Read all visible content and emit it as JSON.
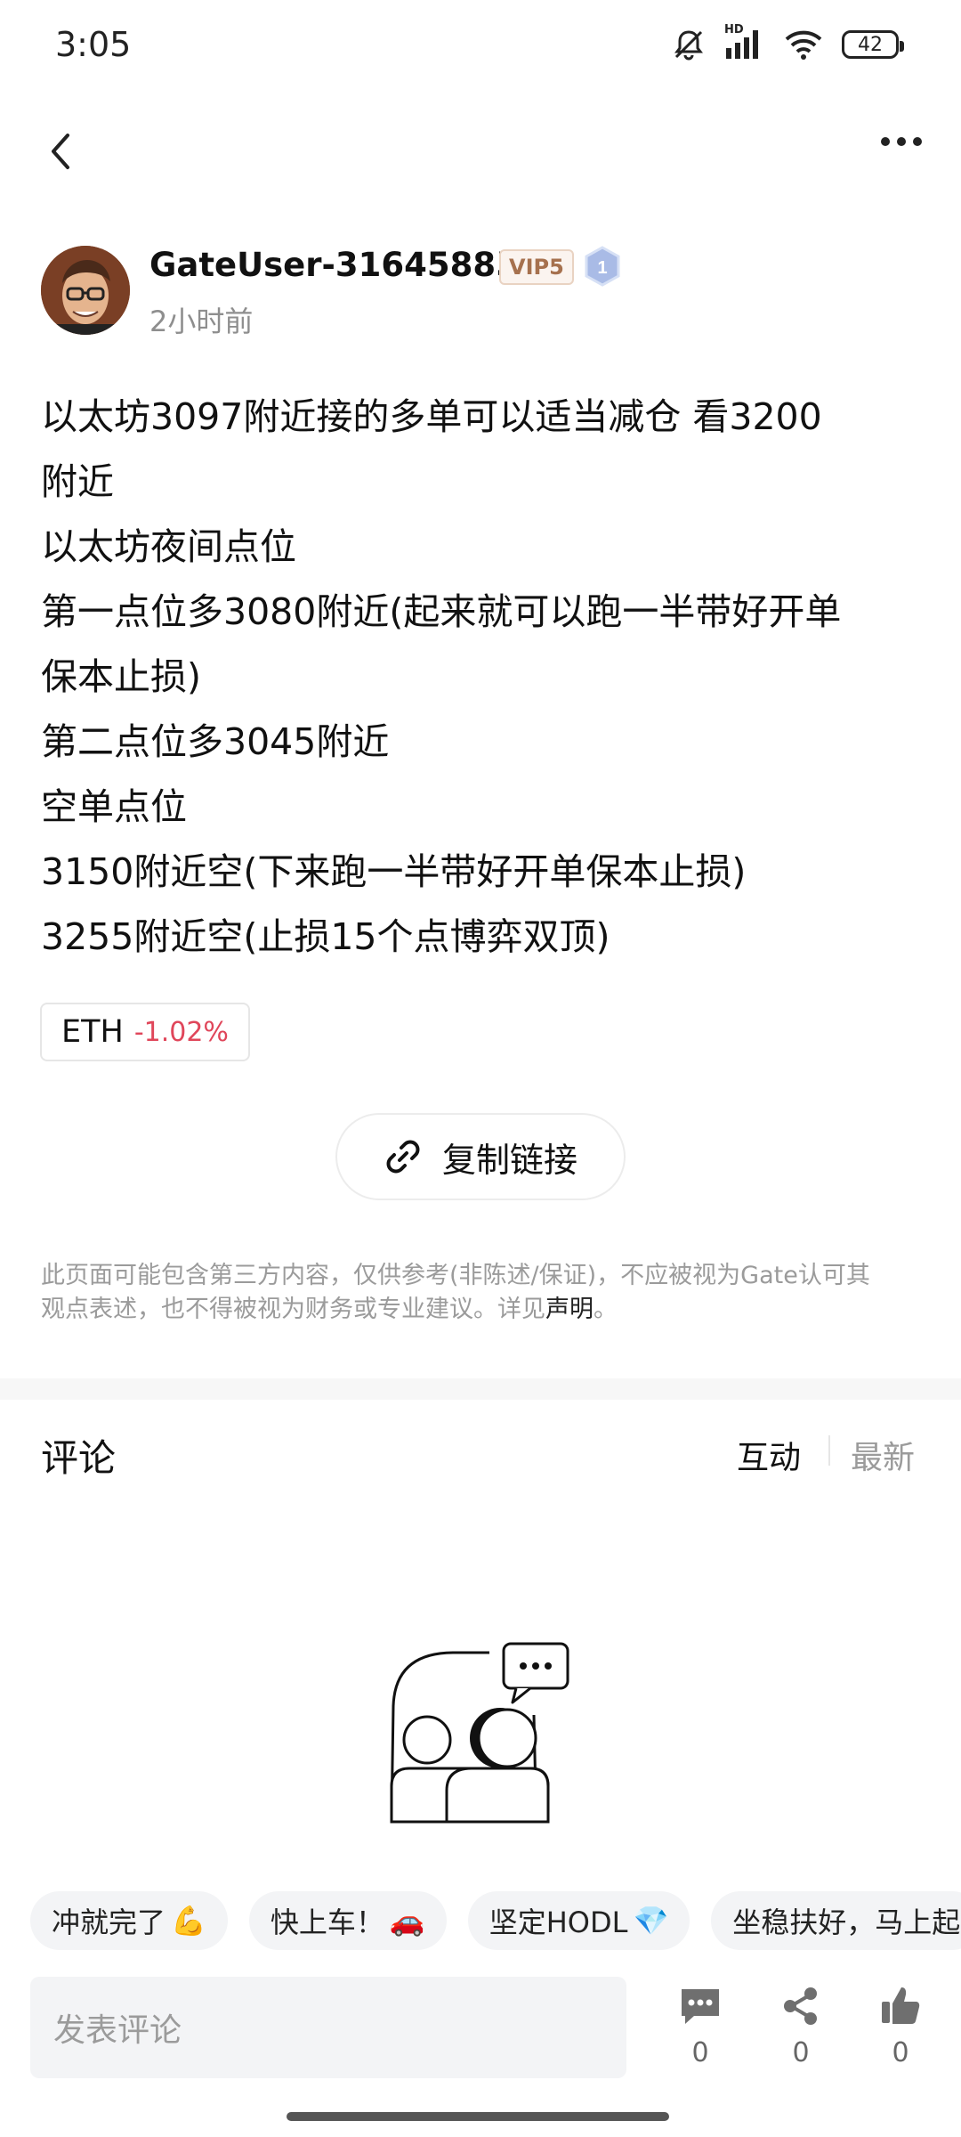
{
  "status_bar": {
    "time": "3:05",
    "network_label": "HD",
    "battery": "42",
    "icons": [
      "mute-bell-icon",
      "signal-icon",
      "wifi-icon",
      "battery-icon"
    ]
  },
  "header": {
    "icons": [
      "back-icon",
      "more-icon"
    ]
  },
  "post": {
    "author": "GateUser-31645885",
    "vip_badge": "VIP5",
    "level": "1",
    "time": "2小时前",
    "lines": [
      "以太坊3097附近接的多单可以适当减仓 看3200",
      "附近",
      "以太坊夜间点位",
      "第一点位多3080附近(起来就可以跑一半带好开单",
      "保本止损)",
      "第二点位多3045附近",
      "空单点位",
      "3150附近空(下来跑一半带好开单保本止损)",
      "3255附近空(止损15个点博弈双顶)"
    ],
    "ticker": {
      "symbol": "ETH",
      "change": "-1.02%",
      "change_color": "#e0465a"
    },
    "copy_link_label": "复制链接",
    "disclaimer_line1": "此页面可能包含第三方内容，仅供参考(非陈述/保证)，不应被视为Gate认可其",
    "disclaimer_line2_prefix": "观点表述，也不得被视为财务或专业建议。详见",
    "disclaimer_link": "声明",
    "disclaimer_suffix": "。"
  },
  "comments": {
    "title": "评论",
    "sort_options": [
      "互动",
      "最新"
    ],
    "active_sort": "互动",
    "quick_replies": [
      {
        "text": "冲就完了",
        "emoji": "💪"
      },
      {
        "text": "快上车！",
        "emoji": "🚗"
      },
      {
        "text": "坚定HODL",
        "emoji": "💎"
      },
      {
        "text": "坐稳扶好，马上起",
        "emoji": ""
      }
    ],
    "input_placeholder": "发表评论",
    "actions": [
      {
        "icon": "comment-icon",
        "count": "0"
      },
      {
        "icon": "share-icon",
        "count": "0"
      },
      {
        "icon": "like-icon",
        "count": "0"
      }
    ]
  }
}
